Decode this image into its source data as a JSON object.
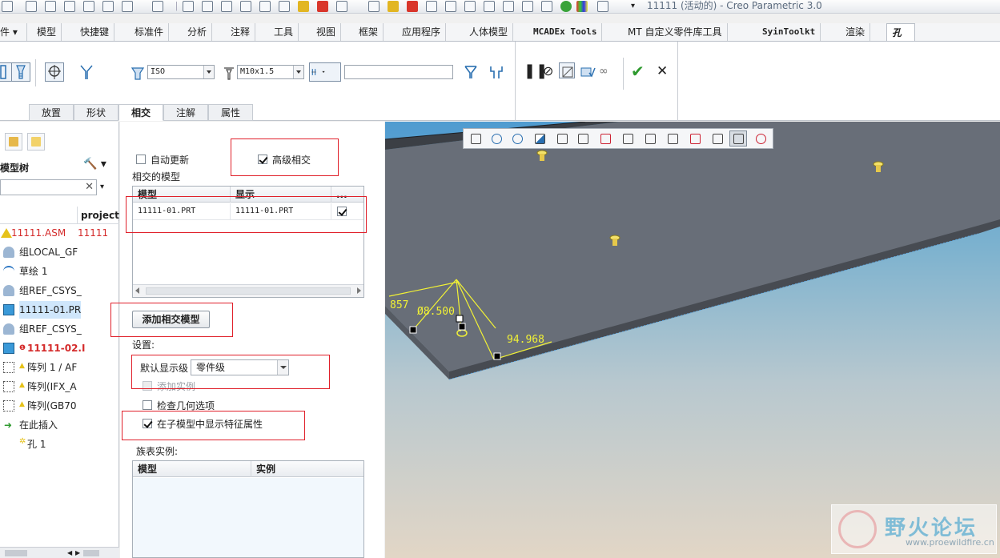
{
  "window": {
    "title": "11111 (活动的) - Creo Parametric 3.0"
  },
  "ribbon_tabs": [
    {
      "label": "件 ▾"
    },
    {
      "label": "模型"
    },
    {
      "label": "快捷键"
    },
    {
      "label": "标准件"
    },
    {
      "label": "分析"
    },
    {
      "label": "注释"
    },
    {
      "label": "工具"
    },
    {
      "label": "视图"
    },
    {
      "label": "框架"
    },
    {
      "label": "应用程序"
    },
    {
      "label": "人体模型"
    },
    {
      "label": "MCADEx Tools"
    },
    {
      "label": "MT 自定义零件库工具"
    },
    {
      "label": "SyinToolkt"
    },
    {
      "label": "渲染"
    },
    {
      "label": "孔"
    }
  ],
  "hole_ribbon": {
    "standard_value": "ISO",
    "screw_size_value": "M10x1.5",
    "depth_value": "",
    "subtabs": [
      {
        "label": "放置"
      },
      {
        "label": "形状"
      },
      {
        "label": "相交"
      },
      {
        "label": "注解"
      },
      {
        "label": "属性"
      }
    ]
  },
  "model_tree": {
    "title": "模型树",
    "column_header": "project_",
    "rows": [
      {
        "label": "11111.ASM",
        "value": "11111",
        "icon": "assembly-icon"
      },
      {
        "label": "组LOCAL_GF",
        "value": "",
        "icon": "group-icon"
      },
      {
        "label": "草绘 1",
        "value": "",
        "icon": "sketch-icon"
      },
      {
        "label": "组REF_CSYS_",
        "value": "",
        "icon": "group-icon"
      },
      {
        "label": "11111-01.PR",
        "value": "",
        "icon": "part-icon"
      },
      {
        "label": "组REF_CSYS_",
        "value": "",
        "icon": "group-icon"
      },
      {
        "label": "11111-02.I",
        "value": "",
        "icon": "part-icon"
      },
      {
        "label": "阵列 1 / AF",
        "value": "",
        "icon": "pattern-icon"
      },
      {
        "label": "阵列(IFX_A",
        "value": "",
        "icon": "pattern-icon"
      },
      {
        "label": "阵列(GB70",
        "value": "",
        "icon": "pattern-icon"
      },
      {
        "label": "在此插入",
        "value": "",
        "icon": "insert-here-icon"
      },
      {
        "label": "孔 1",
        "value": "",
        "icon": "hole-icon"
      }
    ]
  },
  "intersect_panel": {
    "auto_update_label": "自动更新",
    "advanced_intersect_label": "高级相交",
    "intersected_models_label": "相交的模型",
    "table_headers": {
      "model": "模型",
      "display": "显示",
      "more": "..."
    },
    "table_rows": [
      {
        "model": "11111-01.PRT",
        "display": "11111-01.PRT"
      }
    ],
    "add_button": "添加相交模型",
    "settings_label": "设置:",
    "default_level_label": "默认显示级",
    "default_level_value": "零件级",
    "add_instance_label": "添加实例",
    "check_geometry_label": "检查几何选项",
    "show_feature_props_label": "在子模型中显示特征属性",
    "family_label": "族表实例:",
    "family_headers": {
      "model": "模型",
      "instance": "实例"
    }
  },
  "viewport": {
    "dimensions": [
      "857",
      "Ø8.500",
      "94.968"
    ],
    "watermark_text": "野火论坛",
    "watermark_url": "www.proewildfire.cn"
  }
}
